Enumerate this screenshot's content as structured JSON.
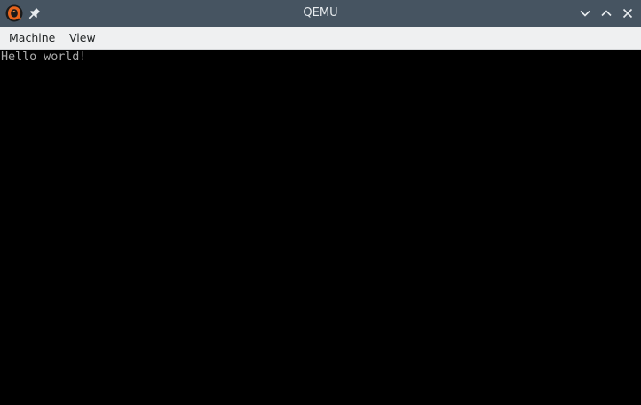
{
  "window": {
    "title": "QEMU",
    "app_icon": "qemu-logo-icon",
    "controls": {
      "pin_icon": "pin-icon",
      "minimize_icon": "chevron-down-icon",
      "maximize_icon": "chevron-up-icon",
      "close_icon": "close-icon"
    },
    "colors": {
      "titlebar": "#465461",
      "menubar": "#eff0f1",
      "screen": "#000000",
      "console_text": "#aaaaaa"
    }
  },
  "menubar": {
    "items": [
      {
        "label": "Machine"
      },
      {
        "label": "View"
      }
    ]
  },
  "console": {
    "lines": [
      "Hello world!"
    ]
  }
}
